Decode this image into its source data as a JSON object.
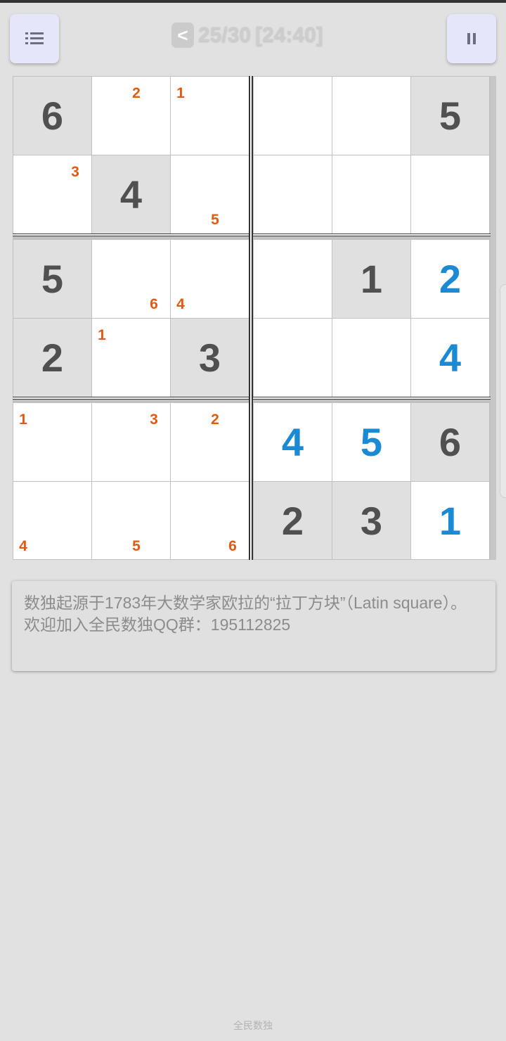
{
  "header": {
    "back_label": "<",
    "progress": "25/30",
    "timer": "[24:40]",
    "menu_icon": "list-icon",
    "pause_icon": "pause-icon"
  },
  "colors": {
    "given": "#505050",
    "entered": "#1a8ad4",
    "note": "#e05a14",
    "given_bg": "#e0e0e0",
    "empty_bg": "#ffffff"
  },
  "board": {
    "size": 6,
    "cells": [
      [
        {
          "v": "6",
          "t": "given"
        },
        {
          "n": [
            {
              "d": "2",
              "p": "tm"
            }
          ]
        },
        {
          "n": [
            {
              "d": "1",
              "p": "tl"
            }
          ]
        },
        {},
        {},
        {
          "v": "5",
          "t": "given"
        }
      ],
      [
        {
          "n": [
            {
              "d": "3",
              "p": "tr"
            }
          ]
        },
        {
          "v": "4",
          "t": "given"
        },
        {
          "n": [
            {
              "d": "5",
              "p": "bm"
            }
          ]
        },
        {},
        {},
        {}
      ],
      [
        {
          "v": "5",
          "t": "given"
        },
        {
          "n": [
            {
              "d": "6",
              "p": "br"
            }
          ]
        },
        {
          "n": [
            {
              "d": "4",
              "p": "bl"
            }
          ]
        },
        {},
        {
          "v": "1",
          "t": "given"
        },
        {
          "v": "2",
          "t": "entered"
        }
      ],
      [
        {
          "v": "2",
          "t": "given"
        },
        {
          "n": [
            {
              "d": "1",
              "p": "tl"
            }
          ]
        },
        {
          "v": "3",
          "t": "given"
        },
        {},
        {},
        {
          "v": "4",
          "t": "entered"
        }
      ],
      [
        {
          "n": [
            {
              "d": "1",
              "p": "tl"
            }
          ]
        },
        {
          "n": [
            {
              "d": "3",
              "p": "tr"
            }
          ]
        },
        {
          "n": [
            {
              "d": "2",
              "p": "tm"
            }
          ]
        },
        {
          "v": "4",
          "t": "entered"
        },
        {
          "v": "5",
          "t": "entered"
        },
        {
          "v": "6",
          "t": "given"
        }
      ],
      [
        {
          "n": [
            {
              "d": "4",
              "p": "bl"
            }
          ]
        },
        {
          "n": [
            {
              "d": "5",
              "p": "bm"
            }
          ]
        },
        {
          "n": [
            {
              "d": "6",
              "p": "br"
            }
          ]
        },
        {
          "v": "2",
          "t": "given"
        },
        {
          "v": "3",
          "t": "given"
        },
        {
          "v": "1",
          "t": "entered"
        }
      ]
    ]
  },
  "info": {
    "line1": "数独起源于1783年大数学家欧拉的“拉丁方块”（Latin square）。",
    "line2": "欢迎加入全民数独QQ群：195112825"
  },
  "footer": {
    "app_name": "全民数独"
  }
}
